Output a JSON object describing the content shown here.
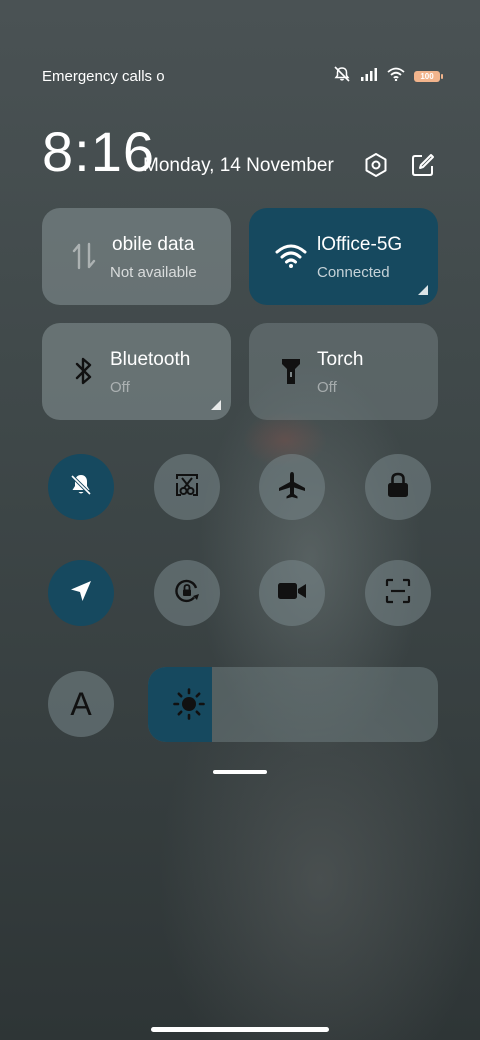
{
  "status_bar": {
    "carrier_text": "Emergency calls o",
    "battery_level": "100",
    "icons": [
      "mute-icon",
      "signal-icon",
      "wifi-icon",
      "battery-icon"
    ]
  },
  "header": {
    "time": "8:16",
    "date": "Monday, 14 November",
    "icons": [
      "settings-icon",
      "edit-icon"
    ]
  },
  "tiles": {
    "mobile_data": {
      "title": "obile data",
      "subtitle": "Not available",
      "icon": "mobile-data-icon",
      "active": false
    },
    "wifi": {
      "title": "lOffice-5G",
      "subtitle": "Connected",
      "icon": "wifi-icon",
      "active": true
    },
    "bluetooth": {
      "title": "Bluetooth",
      "subtitle": "Off",
      "icon": "bluetooth-icon",
      "active": false
    },
    "torch": {
      "title": "Torch",
      "subtitle": "Off",
      "icon": "flashlight-icon",
      "active": false
    }
  },
  "toggles": [
    {
      "name": "silent",
      "icon": "bell-off-icon",
      "active": true
    },
    {
      "name": "screenshot",
      "icon": "scissors-icon",
      "active": false
    },
    {
      "name": "airplane",
      "icon": "airplane-icon",
      "active": false
    },
    {
      "name": "lock-screen",
      "icon": "lock-icon",
      "active": false
    },
    {
      "name": "location",
      "icon": "location-arrow-icon",
      "active": true
    },
    {
      "name": "rotation-lock",
      "icon": "rotation-lock-icon",
      "active": false
    },
    {
      "name": "screen-recorder",
      "icon": "video-camera-icon",
      "active": false
    },
    {
      "name": "scanner",
      "icon": "scan-icon",
      "active": false
    },
    {
      "name": "font",
      "icon": "font-a-icon",
      "active": false
    }
  ],
  "font_button_label": "A",
  "brightness": {
    "level": 0.22,
    "icon": "sun-icon"
  },
  "colors": {
    "accent": "#16495f",
    "tile": "#7a8789",
    "battery": "#f2b48c"
  }
}
